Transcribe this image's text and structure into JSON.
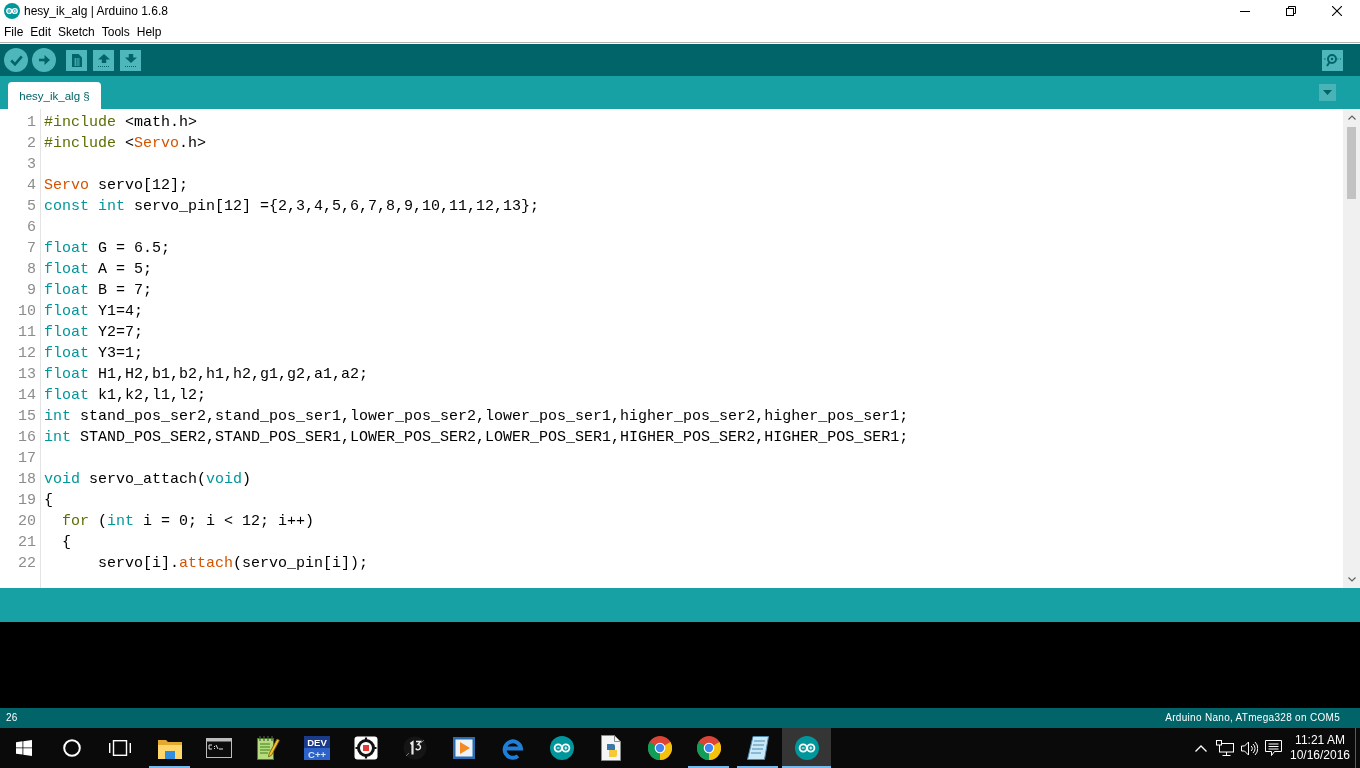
{
  "window": {
    "title": "hesy_ik_alg | Arduino 1.6.8"
  },
  "menu": [
    "File",
    "Edit",
    "Sketch",
    "Tools",
    "Help"
  ],
  "tabs": [
    {
      "label": "hesy_ik_alg §",
      "selected": true
    }
  ],
  "editor": {
    "lines": [
      {
        "number": "1",
        "tokens": [
          {
            "kind": "structure",
            "text": "#include"
          },
          {
            "kind": "plain",
            "text": " <math.h>"
          }
        ]
      },
      {
        "number": "2",
        "tokens": [
          {
            "kind": "structure",
            "text": "#include"
          },
          {
            "kind": "plain",
            "text": " <"
          },
          {
            "kind": "library",
            "text": "Servo"
          },
          {
            "kind": "plain",
            "text": ".h>"
          }
        ]
      },
      {
        "number": "3"
      },
      {
        "number": "4",
        "tokens": [
          {
            "kind": "library",
            "text": "Servo"
          },
          {
            "kind": "plain",
            "text": " servo[12];"
          }
        ]
      },
      {
        "number": "5",
        "tokens": [
          {
            "kind": "type",
            "text": "const"
          },
          {
            "kind": "type",
            "text": " int"
          },
          {
            "kind": "plain",
            "text": " servo_pin[12] ={2,3,4,5,6,7,8,9,10,11,12,13};"
          }
        ]
      },
      {
        "number": "6"
      },
      {
        "number": "7",
        "tokens": [
          {
            "kind": "type",
            "text": "float"
          },
          {
            "kind": "plain",
            "text": " G = 6.5;"
          }
        ]
      },
      {
        "number": "8",
        "tokens": [
          {
            "kind": "type",
            "text": "float"
          },
          {
            "kind": "plain",
            "text": " A = 5;"
          }
        ]
      },
      {
        "number": "9",
        "tokens": [
          {
            "kind": "type",
            "text": "float"
          },
          {
            "kind": "plain",
            "text": " B = 7;"
          }
        ]
      },
      {
        "number": "10",
        "tokens": [
          {
            "kind": "type",
            "text": "float"
          },
          {
            "kind": "plain",
            "text": " Y1=4;"
          }
        ]
      },
      {
        "number": "11",
        "tokens": [
          {
            "kind": "type",
            "text": "float"
          },
          {
            "kind": "plain",
            "text": " Y2=7;"
          }
        ]
      },
      {
        "number": "12",
        "tokens": [
          {
            "kind": "type",
            "text": "float"
          },
          {
            "kind": "plain",
            "text": " Y3=1;"
          }
        ]
      },
      {
        "number": "13",
        "tokens": [
          {
            "kind": "type",
            "text": "float"
          },
          {
            "kind": "plain",
            "text": " H1,H2,b1,b2,h1,h2,g1,g2,a1,a2;"
          }
        ]
      },
      {
        "number": "14",
        "tokens": [
          {
            "kind": "type",
            "text": "float"
          },
          {
            "kind": "plain",
            "text": " k1,k2,l1,l2;"
          }
        ]
      },
      {
        "number": "15",
        "tokens": [
          {
            "kind": "type",
            "text": "int"
          },
          {
            "kind": "plain",
            "text": " stand_pos_ser2,stand_pos_ser1,lower_pos_ser2,lower_pos_ser1,higher_pos_ser2,higher_pos_ser1;"
          }
        ]
      },
      {
        "number": "16",
        "tokens": [
          {
            "kind": "type",
            "text": "int"
          },
          {
            "kind": "plain",
            "text": " STAND_POS_SER2,STAND_POS_SER1,LOWER_POS_SER2,LOWER_POS_SER1,HIGHER_POS_SER2,HIGHER_POS_SER1;"
          }
        ]
      },
      {
        "number": "17"
      },
      {
        "number": "18",
        "tokens": [
          {
            "kind": "type",
            "text": "void"
          },
          {
            "kind": "plain",
            "text": " servo_attach("
          },
          {
            "kind": "type",
            "text": "void"
          },
          {
            "kind": "plain",
            "text": ")"
          }
        ]
      },
      {
        "number": "19",
        "tokens": [
          {
            "kind": "plain",
            "text": "{"
          }
        ]
      },
      {
        "number": "20",
        "tokens": [
          {
            "kind": "structure",
            "text": "  for"
          },
          {
            "kind": "plain",
            "text": " ("
          },
          {
            "kind": "type",
            "text": "int"
          },
          {
            "kind": "plain",
            "text": " i = 0; i < 12; i++)"
          }
        ]
      },
      {
        "number": "21",
        "tokens": [
          {
            "kind": "plain",
            "text": "  {"
          }
        ]
      },
      {
        "number": "22",
        "tokens": [
          {
            "kind": "plain",
            "text": "      servo[i]."
          },
          {
            "kind": "function",
            "text": "attach"
          },
          {
            "kind": "plain",
            "text": "(servo_pin[i]);"
          }
        ]
      }
    ]
  },
  "status_bar": {
    "line": "26",
    "board": "Arduino Nano, ATmega328 on COM5"
  },
  "taskbar": {
    "apps": [
      {
        "kind": "file-explorer",
        "running": true,
        "selected": false
      },
      {
        "kind": "terminal",
        "running": false,
        "selected": false
      },
      {
        "kind": "notepad-plus",
        "running": false,
        "selected": false
      },
      {
        "kind": "dev-ide",
        "logo_text": [
          "DEV",
          "C++"
        ],
        "running": false,
        "selected": false
      },
      {
        "kind": "target-app",
        "running": false,
        "selected": false
      },
      {
        "kind": "emblem-app",
        "running": false,
        "selected": false
      },
      {
        "kind": "media-player",
        "running": false,
        "selected": false
      },
      {
        "kind": "edge",
        "running": false,
        "selected": false
      },
      {
        "kind": "arduino",
        "running": false,
        "selected": false
      },
      {
        "kind": "python-file",
        "running": false,
        "selected": false
      },
      {
        "kind": "chrome",
        "running": false,
        "selected": false
      },
      {
        "kind": "chrome",
        "running": true,
        "selected": false
      },
      {
        "kind": "notepad",
        "running": true,
        "selected": false
      },
      {
        "kind": "arduino",
        "running": true,
        "selected": true
      }
    ],
    "clock": {
      "time": "11:21 AM",
      "date": "10/16/2016"
    }
  }
}
